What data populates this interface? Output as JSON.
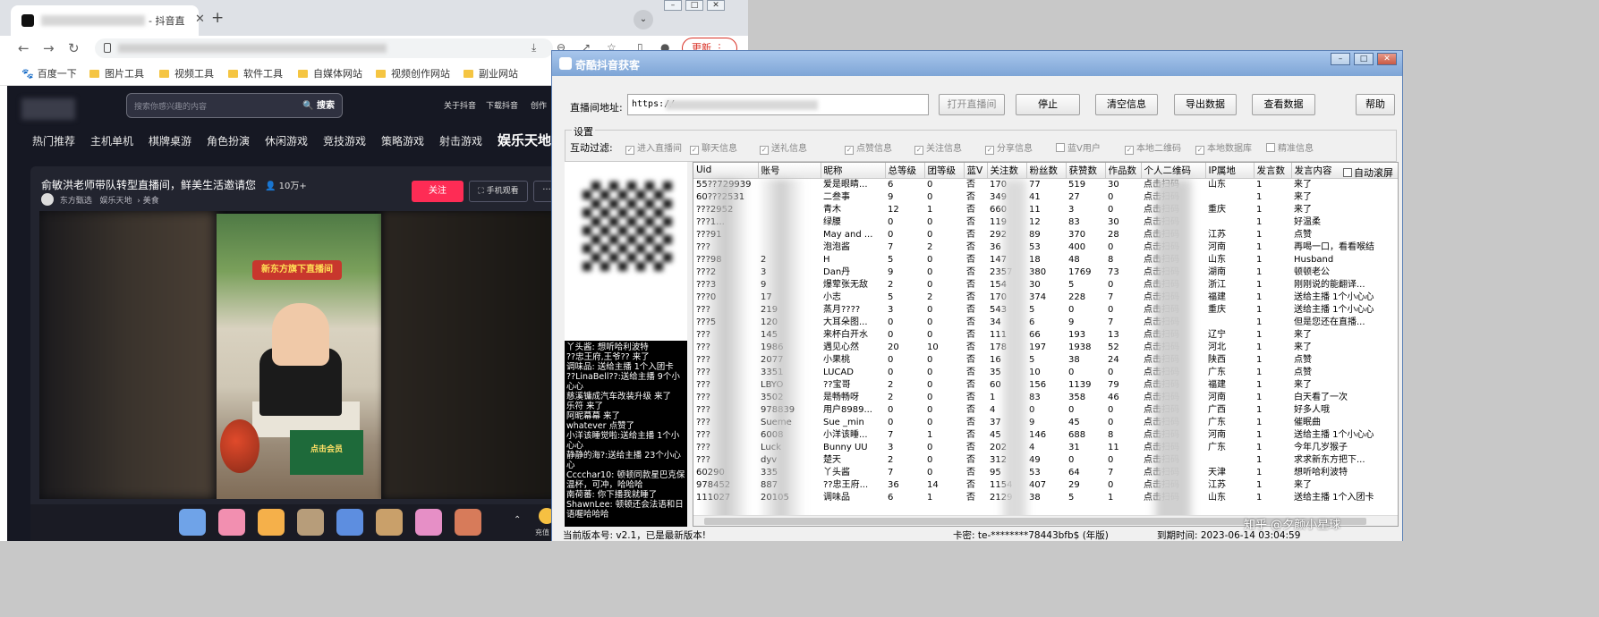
{
  "browser": {
    "tab_title": "- 抖音直",
    "update_label": "更新",
    "bookmarks": [
      "百度一下",
      "图片工具",
      "视频工具",
      "软件工具",
      "自媒体网站",
      "视频创作网站",
      "副业网站"
    ]
  },
  "douyin": {
    "search_placeholder": "搜索你感兴趣的内容",
    "search_button": "搜索",
    "top_links": [
      "关于抖音",
      "下载抖音",
      "创作"
    ],
    "categories": [
      "热门推荐",
      "主机单机",
      "棋牌桌游",
      "角色扮演",
      "休闲游戏",
      "竞技游戏",
      "策略游戏",
      "射击游戏",
      "娱乐天地"
    ],
    "room_title": "俞敏洪老师带队转型直播间，鲜美生活邀请您",
    "viewers": "10万+",
    "room_sub": [
      "东方甄选",
      "娱乐天地",
      "美食"
    ],
    "follow_label": "关注",
    "mobile_label": "手机观看",
    "more_label": "···",
    "video_banner": "新东方旗下直播间",
    "video_green_text": "点击会员",
    "gift_coin_label": "充值"
  },
  "tool": {
    "title": "奇酷抖音获客",
    "url_label": "直播间地址:",
    "url_value": "https://",
    "buttons": [
      "打开直播间",
      "停止",
      "清空信息",
      "导出数据",
      "查看数据",
      "帮助"
    ],
    "settings_label": "设置",
    "filter_label": "互动过滤:",
    "filters": [
      {
        "label": "进入直播间",
        "checked": true
      },
      {
        "label": "聊天信息",
        "checked": true
      },
      {
        "label": "送礼信息",
        "checked": true
      },
      {
        "label": "点赞信息",
        "checked": true
      },
      {
        "label": "关注信息",
        "checked": true
      },
      {
        "label": "分享信息",
        "checked": true
      },
      {
        "label": "蓝V用户",
        "checked": false
      },
      {
        "label": "本地二维码",
        "checked": true
      },
      {
        "label": "本地数据库",
        "checked": true
      },
      {
        "label": "精准信息",
        "checked": false
      }
    ],
    "auto_scroll_label": "自动滚屏",
    "columns": [
      "Uid",
      "账号",
      "昵称",
      "总等级",
      "团等级",
      "蓝V",
      "关注数",
      "粉丝数",
      "获赞数",
      "作品数",
      "个人二维码",
      "IP属地",
      "发言数",
      "发言内容"
    ],
    "rows": [
      [
        "55??729939",
        "",
        "爱是眼睛...",
        "6",
        "0",
        "否",
        "170",
        "77",
        "519",
        "30",
        "点击扫码",
        "山东",
        "1",
        "来了"
      ],
      [
        "60???2531",
        "",
        "二叁事",
        "9",
        "0",
        "否",
        "349",
        "41",
        "27",
        "0",
        "点击扫码",
        "",
        "1",
        "来了"
      ],
      [
        "???2952",
        "",
        "青木",
        "12",
        "1",
        "否",
        "660",
        "11",
        "3",
        "0",
        "点击扫码",
        "重庆",
        "1",
        "来了"
      ],
      [
        "???1...",
        "",
        "绿腰",
        "0",
        "0",
        "否",
        "119",
        "12",
        "83",
        "30",
        "点击扫码",
        "",
        "1",
        "好温柔"
      ],
      [
        "???91",
        "",
        "May and ...",
        "0",
        "0",
        "否",
        "292",
        "89",
        "370",
        "28",
        "点击扫码",
        "江苏",
        "1",
        "点赞"
      ],
      [
        "???",
        "",
        "泡泡酱",
        "7",
        "2",
        "否",
        "36",
        "53",
        "400",
        "0",
        "点击扫码",
        "河南",
        "1",
        "再喝一口，看看喉结"
      ],
      [
        "???98",
        "2",
        "H",
        "5",
        "0",
        "否",
        "147",
        "18",
        "48",
        "8",
        "点击扫码",
        "山东",
        "1",
        "Husband"
      ],
      [
        "???2",
        "3",
        "Dan丹",
        "9",
        "0",
        "否",
        "2357",
        "380",
        "1769",
        "73",
        "点击扫码",
        "湖南",
        "1",
        "顿顿老公"
      ],
      [
        "???3",
        "9",
        "爆荤张无敌",
        "2",
        "0",
        "否",
        "154",
        "30",
        "5",
        "0",
        "点击扫码",
        "浙江",
        "1",
        "刚刚说的能翻译..."
      ],
      [
        "???0",
        "17",
        "小志",
        "5",
        "2",
        "否",
        "170",
        "374",
        "228",
        "7",
        "点击扫码",
        "福建",
        "1",
        "送给主播 1个小心心"
      ],
      [
        "???",
        "219",
        "蒸月????",
        "3",
        "0",
        "否",
        "543",
        "5",
        "0",
        "0",
        "点击扫码",
        "重庆",
        "1",
        "送给主播 1个小心心"
      ],
      [
        "???5",
        "120",
        "大耳朵图...",
        "0",
        "0",
        "否",
        "34",
        "6",
        "9",
        "7",
        "点击扫码",
        "",
        "1",
        "但是您还在直播..."
      ],
      [
        "???",
        "145",
        "来杯白开水",
        "0",
        "0",
        "否",
        "111",
        "66",
        "193",
        "13",
        "点击扫码",
        "辽宁",
        "1",
        "来了"
      ],
      [
        "???",
        "1986",
        "遇见心然",
        "20",
        "10",
        "否",
        "178",
        "197",
        "1938",
        "52",
        "点击扫码",
        "河北",
        "1",
        "来了"
      ],
      [
        "???",
        "2077",
        "小果桃",
        "0",
        "0",
        "否",
        "16",
        "5",
        "38",
        "24",
        "点击扫码",
        "陕西",
        "1",
        "点赞"
      ],
      [
        "???",
        "3351",
        "LUCAD",
        "0",
        "0",
        "否",
        "35",
        "10",
        "0",
        "0",
        "点击扫码",
        "广东",
        "1",
        "点赞"
      ],
      [
        "???",
        "LBYO",
        "??宝哥",
        "2",
        "0",
        "否",
        "60",
        "156",
        "1139",
        "79",
        "点击扫码",
        "福建",
        "1",
        "来了"
      ],
      [
        "???",
        "3502",
        "是畅畅呀",
        "2",
        "0",
        "否",
        "1",
        "83",
        "358",
        "46",
        "点击扫码",
        "河南",
        "1",
        "白天看了一次"
      ],
      [
        "???",
        "978839",
        "用户8989...",
        "0",
        "0",
        "否",
        "4",
        "0",
        "0",
        "0",
        "点击扫码",
        "广西",
        "1",
        "好多人哦"
      ],
      [
        "???",
        "Sueme",
        "Sue _min",
        "0",
        "0",
        "否",
        "37",
        "9",
        "45",
        "0",
        "点击扫码",
        "广东",
        "1",
        "催眠曲"
      ],
      [
        "???",
        "6008",
        "小洋该睡...",
        "7",
        "1",
        "否",
        "45",
        "146",
        "688",
        "8",
        "点击扫码",
        "河南",
        "1",
        "送给主播 1个小心心"
      ],
      [
        "???",
        "Luck",
        "Bunny UU",
        "3",
        "0",
        "否",
        "202",
        "4",
        "31",
        "11",
        "点击扫码",
        "广东",
        "1",
        "今年几岁猴子"
      ],
      [
        "???",
        "dyv",
        "楚天",
        "2",
        "0",
        "否",
        "312",
        "49",
        "0",
        "0",
        "点击扫码",
        "",
        "1",
        "求求新东方把下..."
      ],
      [
        "60290",
        "335",
        "丫头酱",
        "7",
        "0",
        "否",
        "95",
        "53",
        "64",
        "7",
        "点击扫码",
        "天津",
        "1",
        "想听哈利波特"
      ],
      [
        "978452",
        "887",
        "??忠王府...",
        "36",
        "14",
        "否",
        "1154",
        "407",
        "29",
        "0",
        "点击扫码",
        "江苏",
        "1",
        "来了"
      ],
      [
        "111027",
        "20105",
        "调味品",
        "6",
        "1",
        "否",
        "2129",
        "38",
        "5",
        "1",
        "点击扫码",
        "山东",
        "1",
        "送给主播 1个入团卡"
      ]
    ],
    "chat_log": [
      "丫头酱: 想听哈利波特",
      "??忠王府,王爷?? 来了",
      "调味品: 送给主播 1个入团卡",
      "??LinaBell??:送给主播 9个小心心",
      "慈溪镛成汽车改装升级 来了",
      "乐符 来了",
      "阿昵幕幕 来了",
      "whatever 点赞了",
      "小洋该睡觉啦:送给主播 1个小心心",
      "静静的海?:送给主播 23个小心心",
      "Cccchar10: 顿顿同款星巴克保温杯，可冲，哈哈哈",
      "南荷蕃: 你下播我就睡了",
      "ShawnLee: 顿顿还会法语和日语喔哈哈哈"
    ],
    "status": {
      "version": "当前版本号: v2.1，已是最新版本!",
      "card_key": "卡密: te-********78443bfb$ (年版)",
      "expire": "到期时间: 2023-06-14 03:04:59"
    }
  },
  "watermark": "知乎 @夕颜小星球"
}
